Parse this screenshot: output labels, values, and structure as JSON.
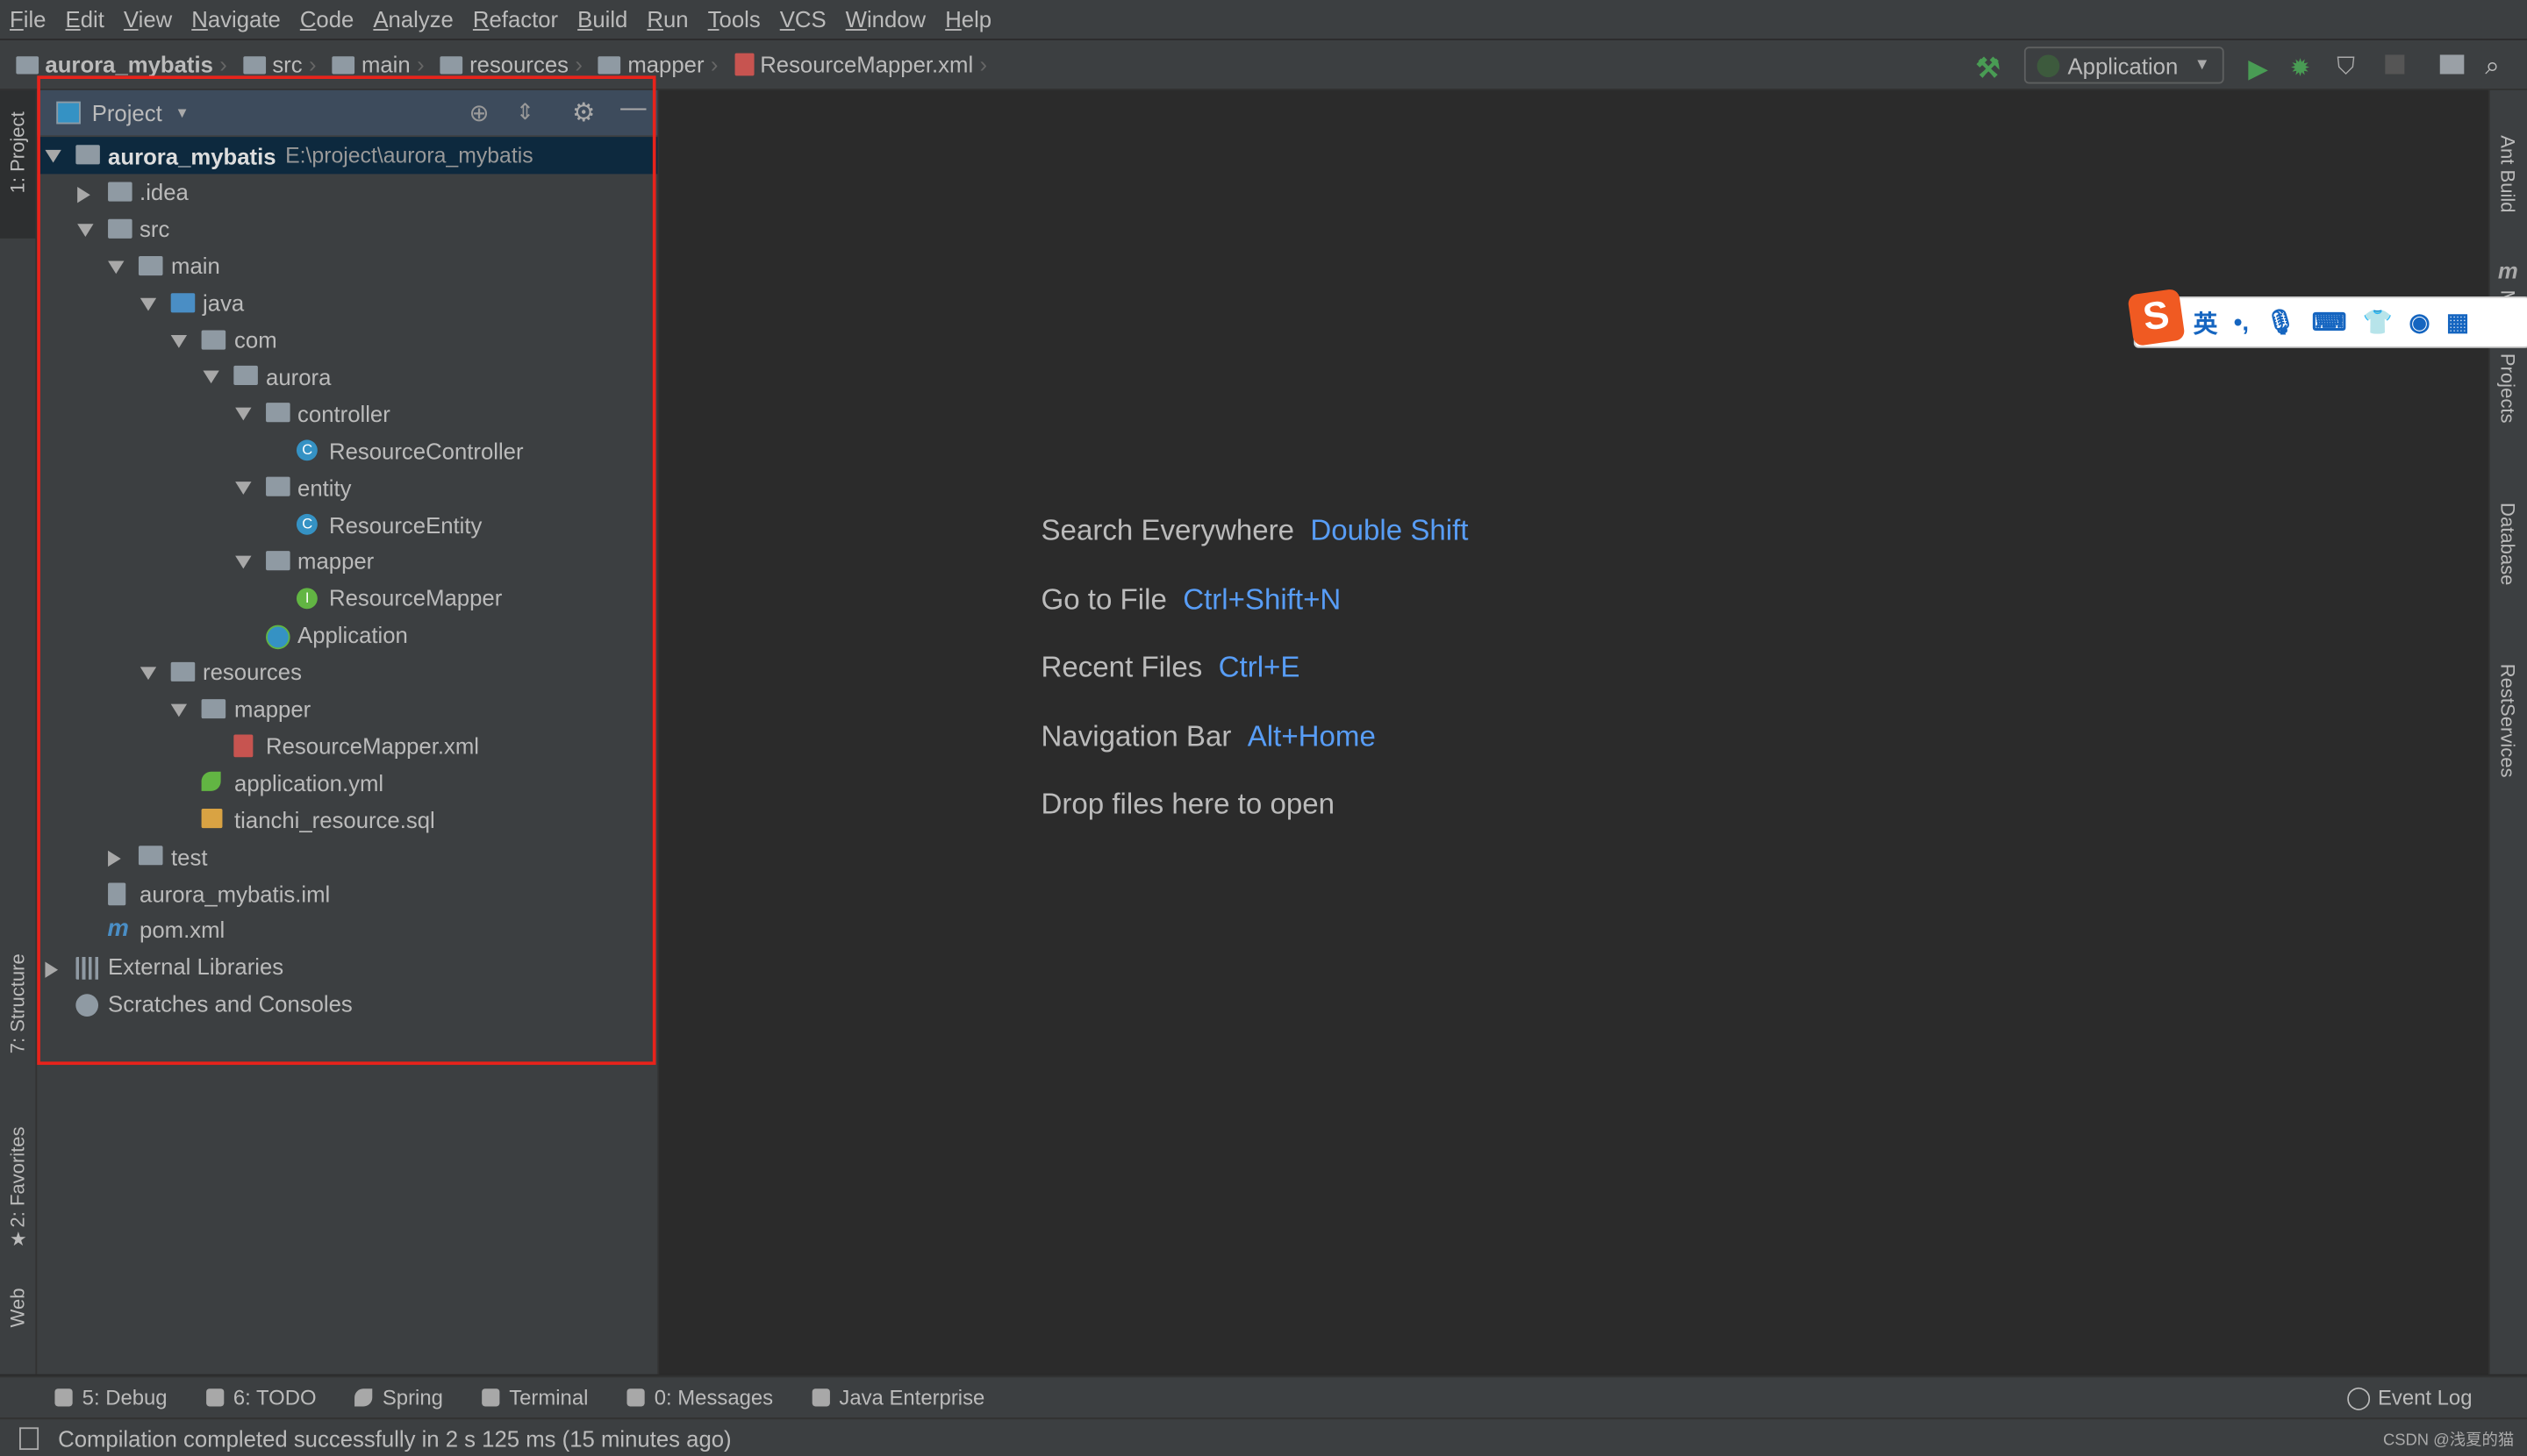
{
  "menu": [
    "File",
    "Edit",
    "View",
    "Navigate",
    "Code",
    "Analyze",
    "Refactor",
    "Build",
    "Run",
    "Tools",
    "VCS",
    "Window",
    "Help"
  ],
  "breadcrumb": [
    "aurora_mybatis",
    "src",
    "main",
    "resources",
    "mapper",
    "ResourceMapper.xml"
  ],
  "run_config": "Application",
  "left_tabs": {
    "project": "1: Project",
    "structure": "7: Structure",
    "favorites": "2: Favorites",
    "web": "Web"
  },
  "right_tabs": {
    "ant": "Ant Build",
    "maven": "Maven Projects",
    "database": "Database",
    "rest": "RestServices"
  },
  "panel": {
    "title": "Project"
  },
  "tree": [
    {
      "label": "aurora_mybatis",
      "path": "E:\\project\\aurora_mybatis",
      "level": 0,
      "state": "open",
      "icon": "module",
      "bold": true,
      "selected": true
    },
    {
      "label": ".idea",
      "level": 1,
      "state": "closed",
      "icon": "folder"
    },
    {
      "label": "src",
      "level": 1,
      "state": "open",
      "icon": "folder"
    },
    {
      "label": "main",
      "level": 2,
      "state": "open",
      "icon": "folder"
    },
    {
      "label": "java",
      "level": 3,
      "state": "open",
      "icon": "src"
    },
    {
      "label": "com",
      "level": 4,
      "state": "open",
      "icon": "pkg"
    },
    {
      "label": "aurora",
      "level": 5,
      "state": "open",
      "icon": "pkg"
    },
    {
      "label": "controller",
      "level": 6,
      "state": "open",
      "icon": "pkg"
    },
    {
      "label": "ResourceController",
      "level": 7,
      "icon": "cls"
    },
    {
      "label": "entity",
      "level": 6,
      "state": "open",
      "icon": "pkg"
    },
    {
      "label": "ResourceEntity",
      "level": 7,
      "icon": "cls"
    },
    {
      "label": "mapper",
      "level": 6,
      "state": "open",
      "icon": "pkg"
    },
    {
      "label": "ResourceMapper",
      "level": 7,
      "icon": "intf"
    },
    {
      "label": "Application",
      "level": 6,
      "icon": "app"
    },
    {
      "label": "resources",
      "level": 3,
      "state": "open",
      "icon": "folder"
    },
    {
      "label": "mapper",
      "level": 4,
      "state": "open",
      "icon": "pkg"
    },
    {
      "label": "ResourceMapper.xml",
      "level": 5,
      "icon": "xml"
    },
    {
      "label": "application.yml",
      "level": 4,
      "icon": "yml"
    },
    {
      "label": "tianchi_resource.sql",
      "level": 4,
      "icon": "sql"
    },
    {
      "label": "test",
      "level": 2,
      "state": "closed",
      "icon": "folder"
    },
    {
      "label": "aurora_mybatis.iml",
      "level": 1,
      "icon": "iml"
    },
    {
      "label": "pom.xml",
      "level": 1,
      "icon": "mvn"
    },
    {
      "label": "External Libraries",
      "level": 0,
      "state": "closed",
      "icon": "lib"
    },
    {
      "label": "Scratches and Consoles",
      "level": 0,
      "icon": "scr"
    }
  ],
  "hints": [
    {
      "text": "Search Everywhere",
      "key": "Double Shift"
    },
    {
      "text": "Go to File",
      "key": "Ctrl+Shift+N"
    },
    {
      "text": "Recent Files",
      "key": "Ctrl+E"
    },
    {
      "text": "Navigation Bar",
      "key": "Alt+Home"
    },
    {
      "text": "Drop files here to open",
      "key": ""
    }
  ],
  "tool_windows": [
    "5: Debug",
    "6: TODO",
    "Spring",
    "Terminal",
    "0: Messages",
    "Java Enterprise"
  ],
  "event_log": "Event Log",
  "status": "Compilation completed successfully in 2 s 125 ms (15 minutes ago)",
  "ime": {
    "mode": "英"
  },
  "watermark": "CSDN @浅夏的猫",
  "colors": {
    "accent": "#589df6",
    "selection": "#0d293e",
    "highlight_box": "#e8231b",
    "run": "#499c54"
  }
}
